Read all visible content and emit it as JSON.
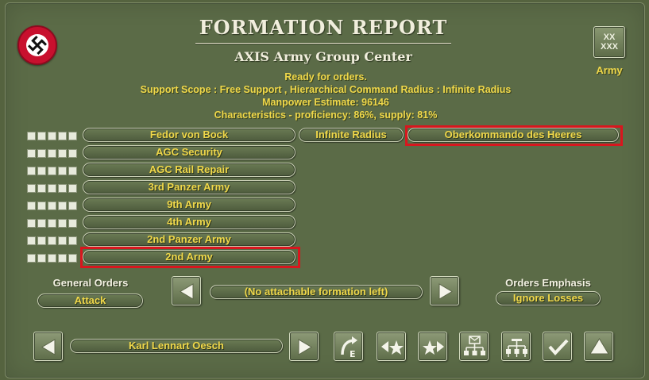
{
  "window": {
    "title": "FORMATION REPORT",
    "subtitle": "AXIS Army Group Center",
    "emblem_icon": "swastika-emblem-icon"
  },
  "status": {
    "line1": "Ready for orders.",
    "line2": "Support Scope :  Free Support ,  Hierarchical Command Radius :  Infinite Radius",
    "line3": "Manpower Estimate: 96146",
    "line4": "Characteristics - proficiency: 86%, supply: 81%"
  },
  "unit_type": {
    "badge_line1": "XX",
    "badge_line2": "XXX",
    "label": "Army"
  },
  "commander_row": {
    "commander": "Fedor von Bock",
    "radius": "Infinite Radius",
    "superior_hq": "Oberkommando des Heeres"
  },
  "subunits": [
    {
      "name": "AGC Security"
    },
    {
      "name": "AGC Rail Repair"
    },
    {
      "name": "3rd Panzer Army"
    },
    {
      "name": "9th Army"
    },
    {
      "name": "4th Army"
    },
    {
      "name": "2nd Panzer Army"
    },
    {
      "name": "2nd Army"
    }
  ],
  "orders": {
    "general_orders_label": "General Orders",
    "general_orders_value": "Attack",
    "attach_value": "(No attachable formation left)",
    "emphasis_label": "Orders Emphasis",
    "emphasis_value": "Ignore Losses"
  },
  "leader": {
    "name": "Karl Lennart Oesch"
  },
  "colors": {
    "panel": "#5b6b47",
    "accent_text": "#f0d84a",
    "highlight": "#d8161e"
  },
  "icons": {
    "prev": "left-arrow-icon",
    "next": "right-arrow-icon",
    "leader_prev": "left-arrow-icon",
    "leader_next": "right-arrow-icon",
    "b1": "replace-leader-icon",
    "b2": "demote-star-icon",
    "b3": "promote-star-icon",
    "b4": "hq-message-icon",
    "b5": "org-chart-icon",
    "b6": "checkmark-icon",
    "b7": "up-triangle-icon"
  }
}
